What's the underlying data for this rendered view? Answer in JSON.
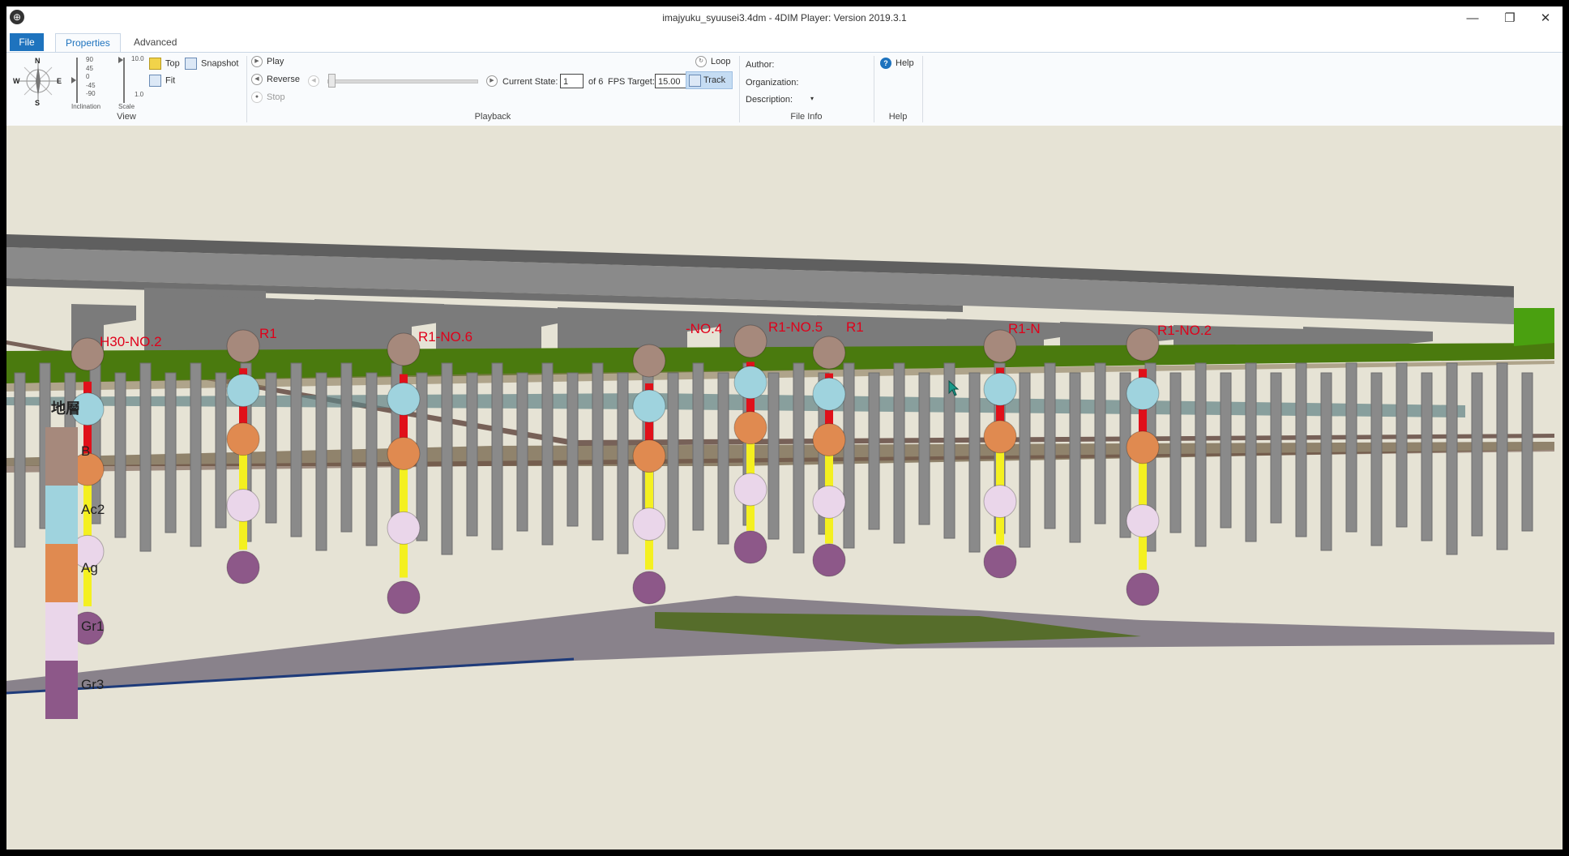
{
  "window": {
    "title": "imajyuku_syuusei3.4dm - 4DIM Player: Version 2019.3.1",
    "controls": {
      "minimize": "—",
      "maximize": "❐",
      "close": "✕"
    }
  },
  "tabs": [
    {
      "label": "File"
    },
    {
      "label": "Properties"
    },
    {
      "label": "Advanced"
    }
  ],
  "ribbon": {
    "view": {
      "group_label": "View",
      "compass": {
        "n": "N",
        "s": "S",
        "e": "E",
        "w": "W"
      },
      "inclination_label": "Inclination",
      "inclination_ticks": [
        "90",
        "45",
        "0",
        "-45",
        "-90"
      ],
      "scale_label": "Scale",
      "scale_ticks": [
        "10.0",
        "1.0"
      ],
      "top_label": "Top",
      "snapshot_label": "Snapshot",
      "fit_label": "Fit"
    },
    "playback": {
      "group_label": "Playback",
      "play_label": "Play",
      "reverse_label": "Reverse",
      "stop_label": "Stop",
      "current_state_label": "Current State:",
      "current_state_value": "1",
      "of_total": "of 6",
      "fps_label": "FPS Target:",
      "fps_value": "15.00",
      "loop_label": "Loop",
      "track_label": "Track"
    },
    "file_info": {
      "group_label": "File Info",
      "author_label": "Author:",
      "organization_label": "Organization:",
      "description_label": "Description:"
    },
    "help": {
      "group_label": "Help",
      "help_label": "Help"
    }
  },
  "viewport": {
    "borehole_labels": [
      "H30-NO.2",
      "R1",
      "R1-NO.6",
      "-NO.4",
      "R1-NO.5",
      "R1",
      "R1-N",
      "R1-NO.2"
    ],
    "legend": {
      "title": "地層",
      "layers": [
        {
          "name": "B",
          "color": "#a6897c"
        },
        {
          "name": "Ac2",
          "color": "#9fd3de"
        },
        {
          "name": "Ag",
          "color": "#e08a50"
        },
        {
          "name": "Gr1",
          "color": "#ead6ea"
        },
        {
          "name": "Gr3",
          "color": "#8d5889"
        }
      ]
    }
  }
}
